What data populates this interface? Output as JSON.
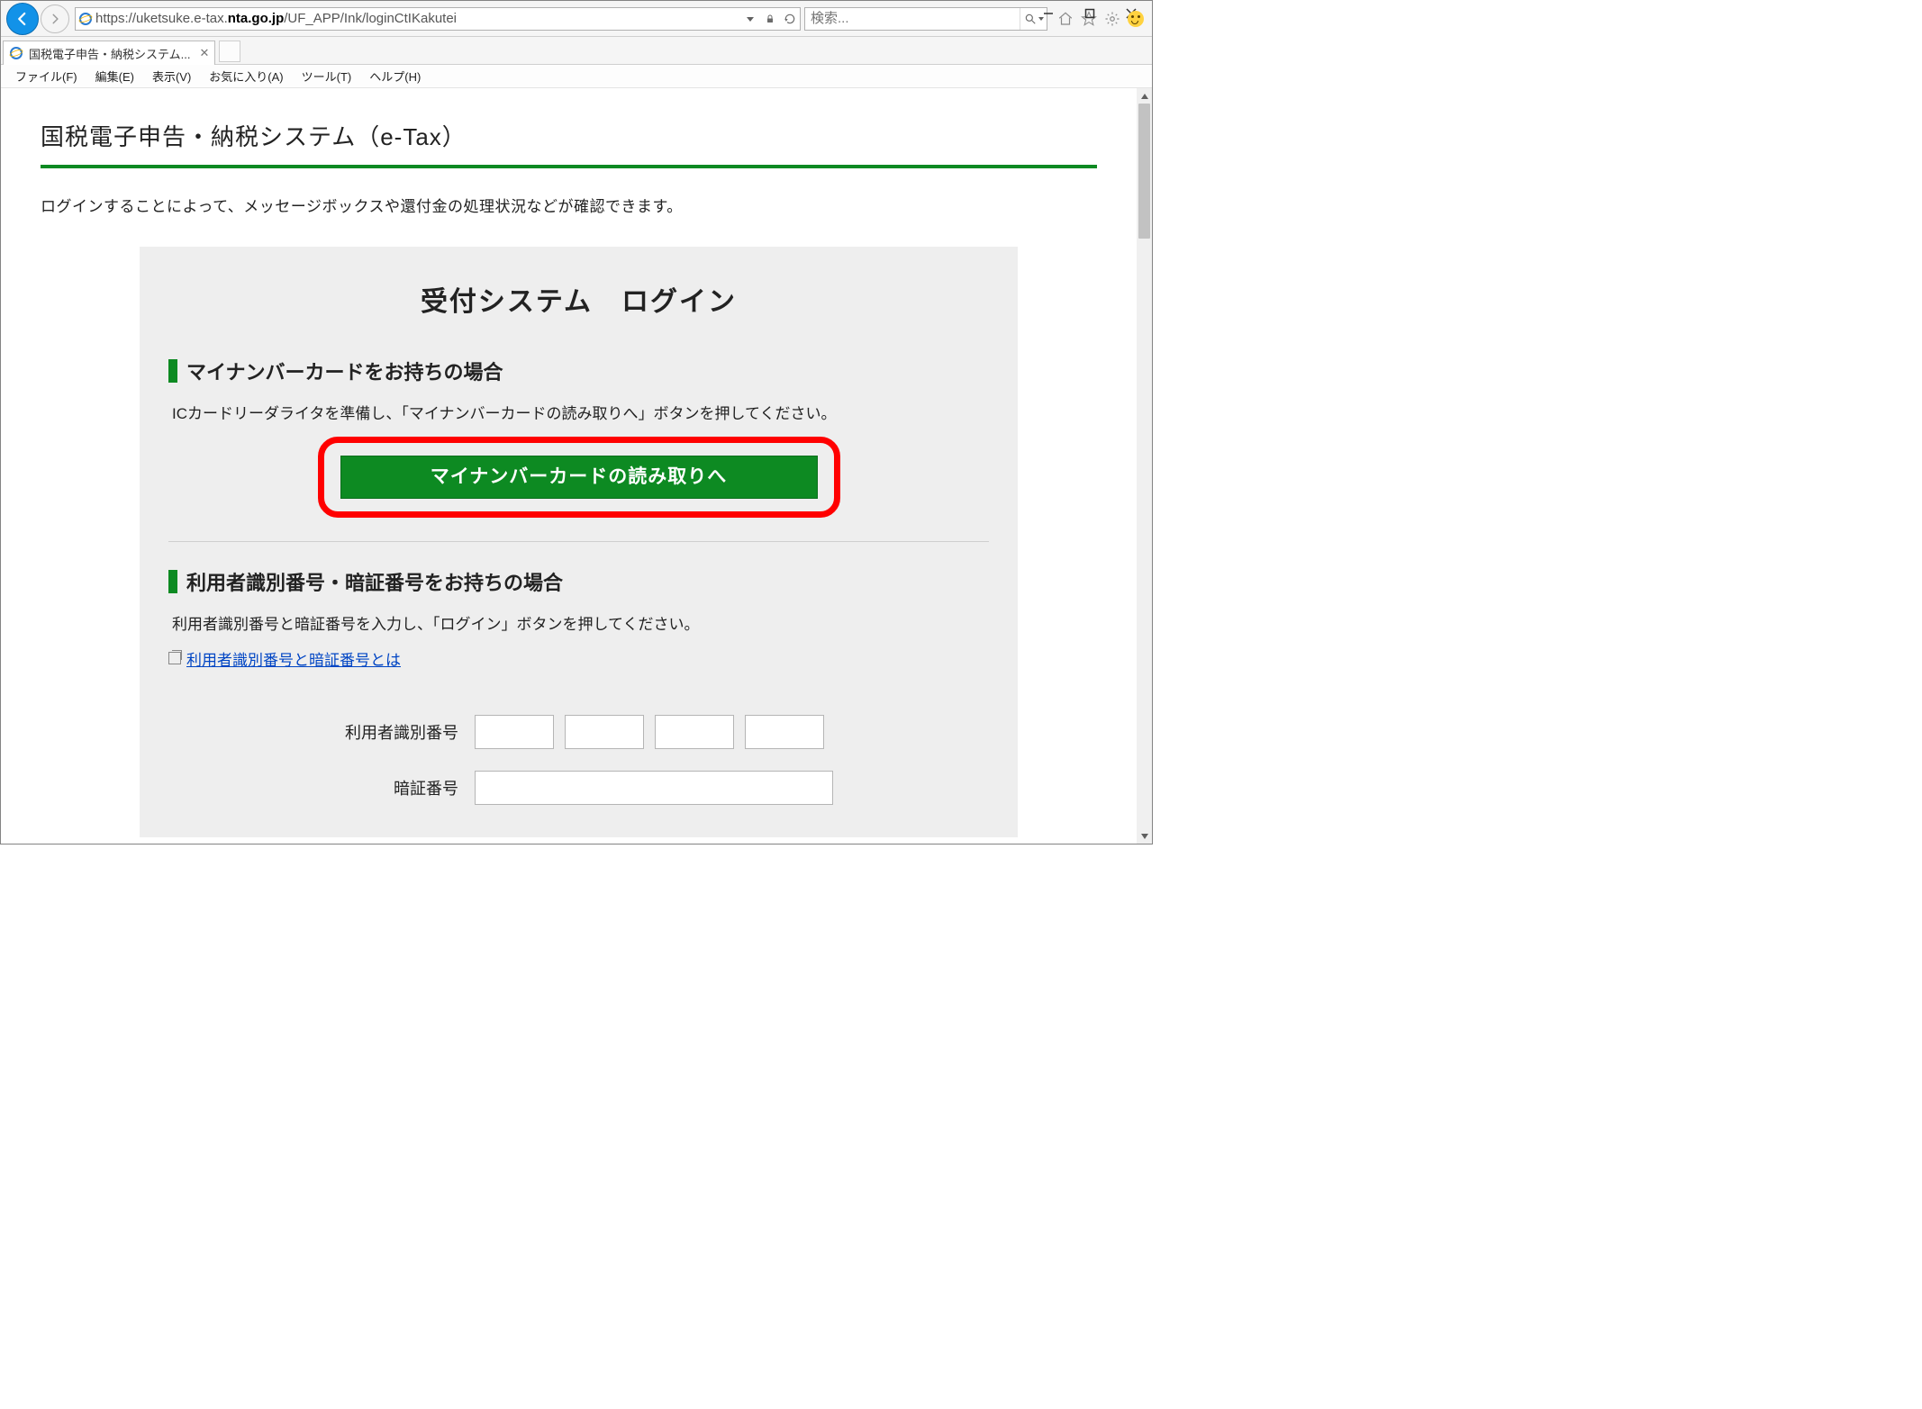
{
  "window": {
    "url_prefix": "https://uketsuke.e-tax.",
    "url_bold": "nta.go.jp",
    "url_suffix": "/UF_APP/Ink/loginCtIKakutei",
    "search_placeholder": "検索...",
    "tab_title": "国税電子申告・納税システム...",
    "menu": {
      "file": "ファイル(F)",
      "edit": "編集(E)",
      "view": "表示(V)",
      "fav": "お気に入り(A)",
      "tool": "ツール(T)",
      "help": "ヘルプ(H)"
    }
  },
  "page": {
    "title": "国税電子申告・納税システム（e-Tax）",
    "intro": "ログインすることによって、メッセージボックスや還付金の処理状況などが確認できます。",
    "panel_title": "受付システム　ログイン",
    "section1": {
      "heading": "マイナンバーカードをお持ちの場合",
      "desc": "ICカードリーダライタを準備し、「マイナンバーカードの読み取りへ」ボタンを押してください。",
      "button": "マイナンバーカードの読み取りへ"
    },
    "section2": {
      "heading": "利用者識別番号・暗証番号をお持ちの場合",
      "desc": "利用者識別番号と暗証番号を入力し、「ログイン」ボタンを押してください。",
      "link": "利用者識別番号と暗証番号とは",
      "label_id": "利用者識別番号",
      "label_pw": "暗証番号"
    }
  }
}
